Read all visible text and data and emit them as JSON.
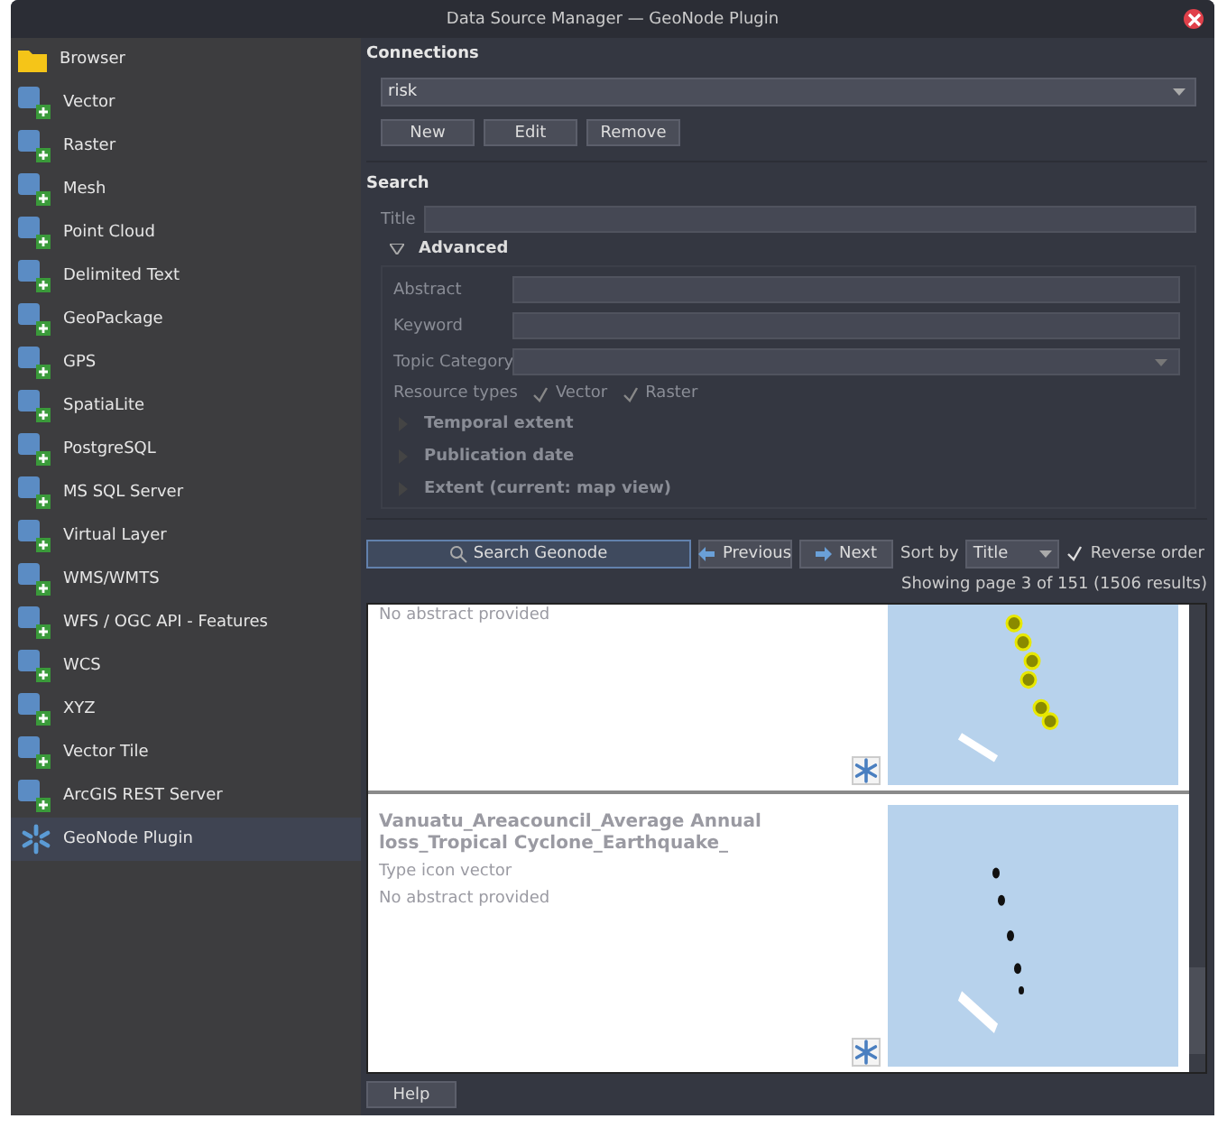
{
  "window": {
    "title": "Data Source Manager — GeoNode Plugin"
  },
  "sidebar": {
    "items": [
      {
        "label": "Browser",
        "selected": false
      },
      {
        "label": "Vector",
        "selected": false
      },
      {
        "label": "Raster",
        "selected": false
      },
      {
        "label": "Mesh",
        "selected": false
      },
      {
        "label": "Point Cloud",
        "selected": false
      },
      {
        "label": "Delimited Text",
        "selected": false
      },
      {
        "label": "GeoPackage",
        "selected": false
      },
      {
        "label": "GPS",
        "selected": false
      },
      {
        "label": "SpatiaLite",
        "selected": false
      },
      {
        "label": "PostgreSQL",
        "selected": false
      },
      {
        "label": "MS SQL Server",
        "selected": false
      },
      {
        "label": "Virtual Layer",
        "selected": false
      },
      {
        "label": "WMS/WMTS",
        "selected": false
      },
      {
        "label": "WFS / OGC API - Features",
        "selected": false
      },
      {
        "label": "WCS",
        "selected": false
      },
      {
        "label": "XYZ",
        "selected": false
      },
      {
        "label": "Vector Tile",
        "selected": false
      },
      {
        "label": "ArcGIS REST Server",
        "selected": false
      },
      {
        "label": "GeoNode Plugin",
        "selected": true
      }
    ]
  },
  "connections": {
    "heading": "Connections",
    "selected_connection": "risk",
    "buttons": [
      "New",
      "Edit",
      "Remove"
    ]
  },
  "search": {
    "heading": "Search",
    "title_label": "Title",
    "advanced": {
      "label": "Advanced",
      "expanded": true,
      "fields": [
        {
          "label": "Abstract",
          "kind": "text"
        },
        {
          "label": "Keyword",
          "kind": "text"
        },
        {
          "label": "Topic Category",
          "kind": "dropdown"
        }
      ],
      "resource_types_label": "Resource types",
      "resource_types": [
        {
          "label": "Vector",
          "checked": true
        },
        {
          "label": "Raster",
          "checked": true
        }
      ],
      "sections": [
        {
          "label": "Temporal extent",
          "expanded": false
        },
        {
          "label": "Publication date",
          "expanded": false
        },
        {
          "label": "Extent (current: map view)",
          "expanded": false
        }
      ]
    }
  },
  "toolbar": {
    "search_button": "Search Geonode",
    "previous_button": "Previous",
    "next_button": "Next",
    "sort_label": "Sort by",
    "sort_value": "Title",
    "reverse_order": {
      "label": "Reverse order",
      "checked": true
    }
  },
  "status": "Showing page 3 of 151 (1506 results)",
  "results": [
    {
      "abstract": "No abstract provided"
    },
    {
      "title": "Vanuatu_Areacouncil_Average Annual loss_Tropical Cyclone_Earthquake_",
      "type": "Type icon  vector",
      "abstract": "No abstract provided"
    }
  ],
  "help_button": "Help"
}
